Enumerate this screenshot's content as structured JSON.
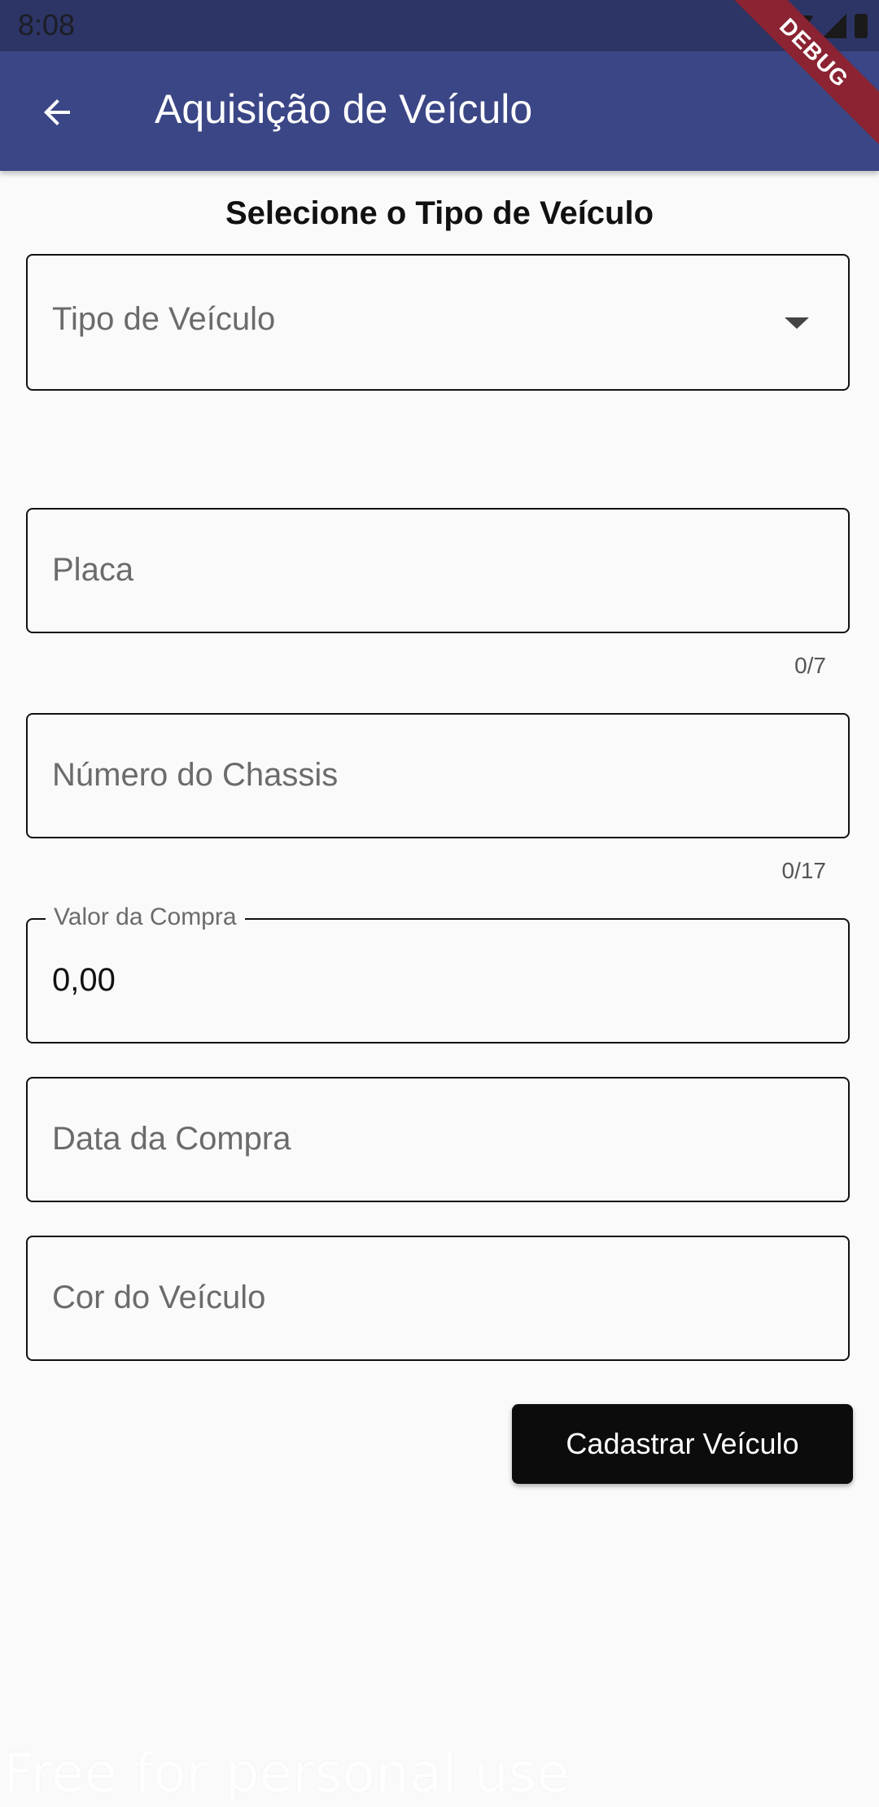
{
  "status_bar": {
    "time": "8:08",
    "icons": [
      "wifi-icon",
      "signal-icon",
      "battery-icon"
    ]
  },
  "app_bar": {
    "title": "Aquisição de Veículo",
    "back_icon": "arrow-back-icon",
    "background": "#3b4686"
  },
  "debug_banner": "DEBUG",
  "form": {
    "section_heading": "Selecione o Tipo de Veículo",
    "vehicle_type": {
      "placeholder": "Tipo de Veículo",
      "icon": "dropdown-arrow-icon"
    },
    "plate": {
      "placeholder": "Placa",
      "counter": "0/7"
    },
    "chassis": {
      "placeholder": "Número do Chassis",
      "counter": "0/17"
    },
    "purchase_value": {
      "label": "Valor da Compra",
      "value": "0,00"
    },
    "purchase_date": {
      "placeholder": "Data da Compra"
    },
    "vehicle_color": {
      "placeholder": "Cor do Veículo"
    },
    "submit_label": "Cadastrar Veículo"
  },
  "watermark": "Free for personal use"
}
